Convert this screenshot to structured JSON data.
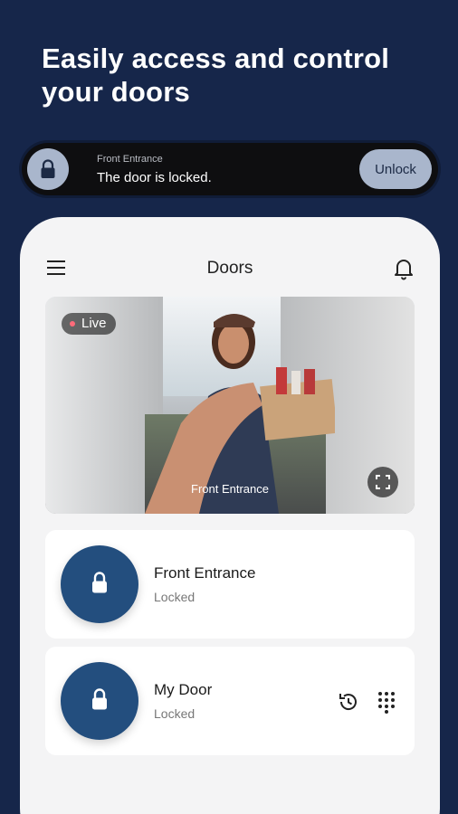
{
  "headline": {
    "line1": "Easily access and control",
    "line2": "your doors"
  },
  "notification": {
    "title": "Front Entrance",
    "message": "The door is locked.",
    "action_label": "Unlock"
  },
  "app": {
    "title": "Doors",
    "camera": {
      "live_label": "Live",
      "door_label": "Front Entrance"
    },
    "doors": [
      {
        "name": "Front Entrance",
        "status": "Locked"
      },
      {
        "name": "My Door",
        "status": "Locked"
      }
    ]
  },
  "colors": {
    "background": "#16264a",
    "lock_circle": "#234e7e",
    "notif_accent": "#a9b6cc",
    "live_dot": "#ff6b7a"
  },
  "icons": [
    "lock-icon",
    "menu-icon",
    "bell-icon",
    "expand-icon",
    "history-icon",
    "keypad-icon"
  ]
}
